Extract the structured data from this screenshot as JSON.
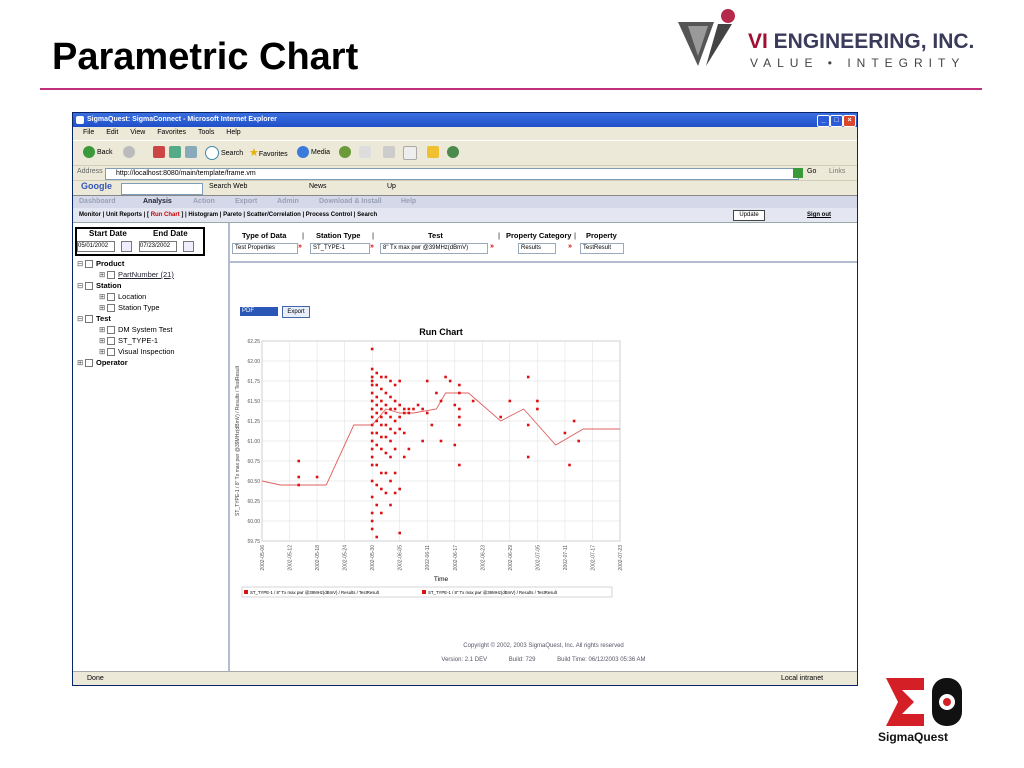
{
  "slide": {
    "title": "Parametric Chart",
    "company_initials": "VI",
    "company_name": " ENGINEERING, INC.",
    "company_tagline": "VALUE • INTEGRITY",
    "footer_logo": "SigmaQuest"
  },
  "window": {
    "title": "SigmaQuest: SigmaConnect - Microsoft Internet Explorer",
    "menu": [
      "File",
      "Edit",
      "View",
      "Favorites",
      "Tools",
      "Help"
    ],
    "toolbar": {
      "back": "Back",
      "search": "Search",
      "favorites": "Favorites",
      "media": "Media"
    },
    "address_label": "Address",
    "address": "http://localhost:8080/main/template/frame.vm",
    "go": "Go",
    "links": "Links",
    "google": {
      "logo": "Google",
      "search_web": "Search Web",
      "news": "News",
      "up": "Up"
    }
  },
  "app": {
    "tabs": [
      "Dashboard",
      "Analysis",
      "Action",
      "Export",
      "Admin",
      "Download & Install",
      "Help"
    ],
    "active_tab": "Analysis",
    "subnav": {
      "prefix": "Monitor | Unit Reports | [",
      "active": " Run Chart ",
      "suffix": "] | Histogram | Pareto | Scatter/Correlation | Process Control | Search"
    },
    "update": "Update",
    "sign_out": "Sign out"
  },
  "dates": {
    "start_label": "Start Date",
    "end_label": "End Date",
    "start": "05/01/2002",
    "end": "07/23/2002"
  },
  "tree": [
    {
      "label": "Product",
      "level": 0,
      "bold": true,
      "exp": "⊟"
    },
    {
      "label": "PartNumber (21)",
      "level": 1,
      "bold": false,
      "exp": "⊞",
      "link": true
    },
    {
      "label": "Station",
      "level": 0,
      "bold": true,
      "exp": "⊟"
    },
    {
      "label": "Location",
      "level": 1,
      "bold": false,
      "exp": "⊞"
    },
    {
      "label": "Station Type",
      "level": 1,
      "bold": false,
      "exp": "⊞"
    },
    {
      "label": "Test",
      "level": 0,
      "bold": true,
      "exp": "⊟"
    },
    {
      "label": "DM System Test",
      "level": 1,
      "bold": false,
      "exp": "⊞"
    },
    {
      "label": "ST_TYPE-1",
      "level": 1,
      "bold": false,
      "exp": "⊞"
    },
    {
      "label": "Visual Inspection",
      "level": 1,
      "bold": false,
      "exp": "⊞"
    },
    {
      "label": "Operator",
      "level": 0,
      "bold": true,
      "exp": "⊞"
    }
  ],
  "filters": {
    "headers": [
      "Type of Data",
      "Station Type",
      "Test",
      "Property Category",
      "Property"
    ],
    "values": {
      "type": "Test Properties",
      "station": "ST_TYPE-1",
      "test": "8\" Tx max pwr @39MHz(dBmV)",
      "category": "Results",
      "property": "TestResult"
    }
  },
  "export": {
    "format": "PDF",
    "button": "Export"
  },
  "chart_data": {
    "type": "scatter",
    "title": "Run Chart",
    "xlabel": "Time",
    "ylabel": "ST_TYPE-1 / 8\" Tx max pwr @39MHz(dBmV) / Results / TestResult",
    "x_ticks": [
      "2002-05-06",
      "2002-05-12",
      "2002-05-18",
      "2002-05-24",
      "2002-05-30",
      "2002-06-05",
      "2002-06-11",
      "2002-06-17",
      "2002-06-23",
      "2002-06-29",
      "2002-07-05",
      "2002-07-11",
      "2002-07-17",
      "2002-07-23"
    ],
    "y_ticks": [
      "59.75",
      "60.00",
      "60.25",
      "60.50",
      "60.75",
      "61.00",
      "61.25",
      "61.50",
      "61.75",
      "62.00",
      "62.25"
    ],
    "ylim": [
      59.75,
      62.25
    ],
    "legend": [
      "ST_TYPE-1 / 8\" Tx max pwr @39MHz(dBmV) / Results / TestResult",
      "ST_TYPE-1 / 8\" Tx max pwr @39MHz(dBmV) / Results / TestResult"
    ],
    "legend_position": "bottom",
    "colors": {
      "points": "#dd1111",
      "line": "#e06060"
    },
    "series": [
      {
        "kind": "points",
        "points": [
          [
            8,
            60.55
          ],
          [
            8,
            60.45
          ],
          [
            8,
            60.75
          ],
          [
            12,
            60.55
          ],
          [
            24,
            62.15
          ],
          [
            24,
            61.9
          ],
          [
            24,
            61.8
          ],
          [
            24,
            61.75
          ],
          [
            24,
            61.7
          ],
          [
            24,
            61.6
          ],
          [
            24,
            61.5
          ],
          [
            24,
            61.4
          ],
          [
            24,
            61.3
          ],
          [
            24,
            61.2
          ],
          [
            24,
            61.1
          ],
          [
            24,
            61.0
          ],
          [
            24,
            60.9
          ],
          [
            24,
            60.8
          ],
          [
            24,
            60.7
          ],
          [
            24,
            60.5
          ],
          [
            24,
            60.3
          ],
          [
            24,
            60.1
          ],
          [
            24,
            60.0
          ],
          [
            24,
            59.9
          ],
          [
            25,
            61.85
          ],
          [
            25,
            61.7
          ],
          [
            25,
            61.55
          ],
          [
            25,
            61.45
          ],
          [
            25,
            61.35
          ],
          [
            25,
            61.25
          ],
          [
            25,
            61.1
          ],
          [
            25,
            60.95
          ],
          [
            25,
            60.7
          ],
          [
            25,
            60.45
          ],
          [
            25,
            60.2
          ],
          [
            25,
            59.8
          ],
          [
            26,
            61.8
          ],
          [
            26,
            61.65
          ],
          [
            26,
            61.5
          ],
          [
            26,
            61.4
          ],
          [
            26,
            61.3
          ],
          [
            26,
            61.2
          ],
          [
            26,
            61.05
          ],
          [
            26,
            60.9
          ],
          [
            26,
            60.6
          ],
          [
            26,
            60.4
          ],
          [
            26,
            60.1
          ],
          [
            27,
            61.8
          ],
          [
            27,
            61.6
          ],
          [
            27,
            61.45
          ],
          [
            27,
            61.35
          ],
          [
            27,
            61.2
          ],
          [
            27,
            61.05
          ],
          [
            27,
            60.85
          ],
          [
            27,
            60.6
          ],
          [
            27,
            60.35
          ],
          [
            28,
            61.75
          ],
          [
            28,
            61.55
          ],
          [
            28,
            61.4
          ],
          [
            28,
            61.3
          ],
          [
            28,
            61.15
          ],
          [
            28,
            61.0
          ],
          [
            28,
            60.8
          ],
          [
            28,
            60.5
          ],
          [
            28,
            60.2
          ],
          [
            29,
            61.7
          ],
          [
            29,
            61.5
          ],
          [
            29,
            61.4
          ],
          [
            29,
            61.25
          ],
          [
            29,
            61.1
          ],
          [
            29,
            60.9
          ],
          [
            29,
            60.6
          ],
          [
            29,
            60.35
          ],
          [
            30,
            61.75
          ],
          [
            30,
            61.45
          ],
          [
            30,
            61.3
          ],
          [
            30,
            61.15
          ],
          [
            30,
            60.4
          ],
          [
            30,
            59.85
          ],
          [
            31,
            61.4
          ],
          [
            31,
            61.35
          ],
          [
            31,
            61.1
          ],
          [
            31,
            60.8
          ],
          [
            32,
            61.4
          ],
          [
            32,
            61.35
          ],
          [
            32,
            60.9
          ],
          [
            33,
            61.4
          ],
          [
            34,
            61.45
          ],
          [
            35,
            61.4
          ],
          [
            35,
            61.0
          ],
          [
            36,
            61.75
          ],
          [
            36,
            61.35
          ],
          [
            37,
            61.2
          ],
          [
            38,
            61.6
          ],
          [
            39,
            61.5
          ],
          [
            39,
            61.0
          ],
          [
            40,
            61.8
          ],
          [
            41,
            61.75
          ],
          [
            42,
            61.45
          ],
          [
            42,
            60.95
          ],
          [
            43,
            61.7
          ],
          [
            43,
            61.6
          ],
          [
            43,
            61.4
          ],
          [
            43,
            61.3
          ],
          [
            43,
            61.2
          ],
          [
            43,
            60.7
          ],
          [
            46,
            61.5
          ],
          [
            52,
            61.3
          ],
          [
            54,
            61.5
          ],
          [
            58,
            61.8
          ],
          [
            58,
            61.2
          ],
          [
            58,
            60.8
          ],
          [
            60,
            61.5
          ],
          [
            60,
            61.4
          ],
          [
            66,
            61.1
          ],
          [
            67,
            60.7
          ],
          [
            68,
            61.25
          ],
          [
            69,
            61.0
          ]
        ]
      },
      {
        "kind": "line",
        "points": [
          [
            0,
            60.5
          ],
          [
            4,
            60.45
          ],
          [
            8,
            60.45
          ],
          [
            14,
            60.45
          ],
          [
            20,
            61.2
          ],
          [
            24,
            61.2
          ],
          [
            27,
            61.4
          ],
          [
            30,
            61.35
          ],
          [
            33,
            61.35
          ],
          [
            38,
            61.4
          ],
          [
            40,
            61.6
          ],
          [
            45,
            61.6
          ],
          [
            52,
            61.25
          ],
          [
            57,
            61.4
          ],
          [
            64,
            60.95
          ],
          [
            70,
            61.15
          ],
          [
            78,
            61.15
          ]
        ]
      }
    ]
  },
  "footer": {
    "copyright": "Copyright © 2002, 2003 SigmaQuest, Inc. All rights reserved",
    "version": "Version: 2.1 DEV",
    "build": "Build: 729",
    "build_time": "Build Time: 06/12/2003 05:36 AM"
  },
  "status": {
    "left": "Done",
    "right": "Local intranet"
  }
}
